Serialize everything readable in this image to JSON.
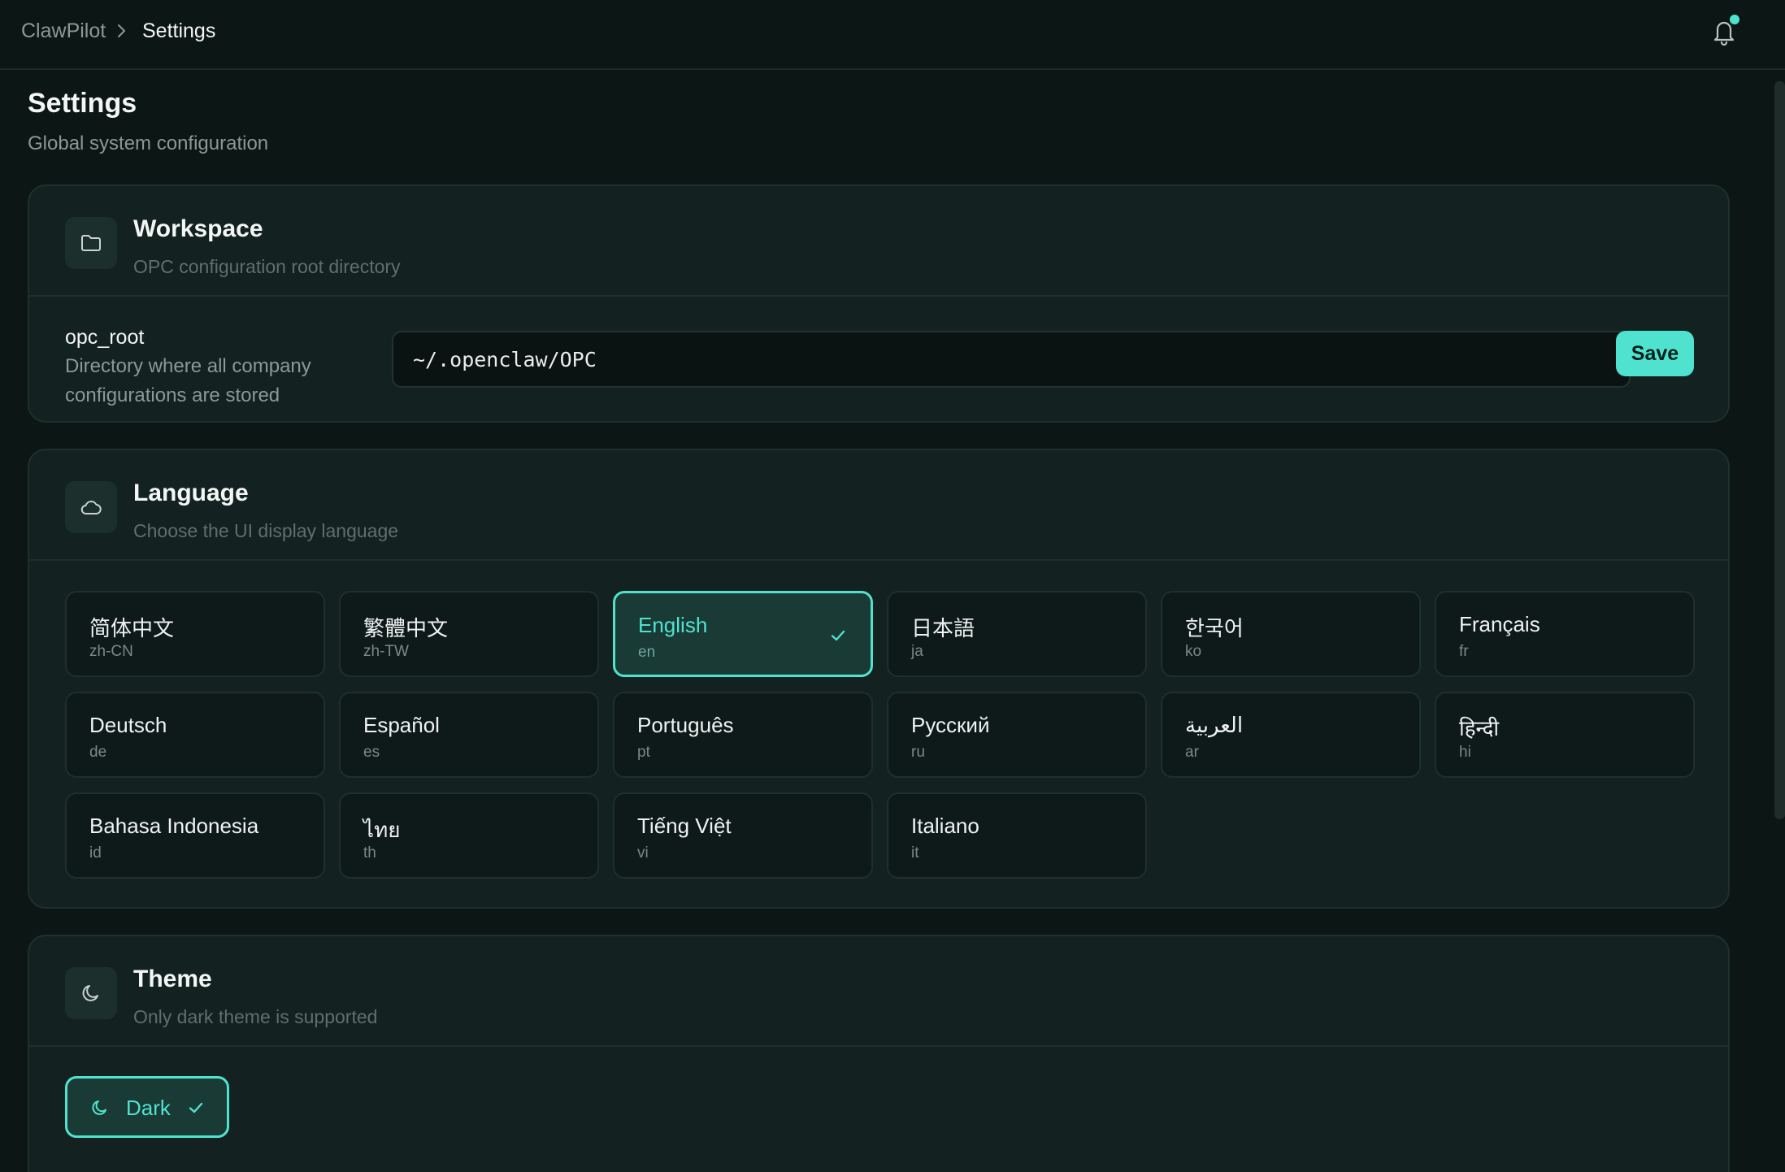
{
  "breadcrumb": {
    "root": "ClawPilot",
    "current": "Settings"
  },
  "page": {
    "title": "Settings",
    "subtitle": "Global system configuration"
  },
  "workspace": {
    "title": "Workspace",
    "description": "OPC configuration root directory",
    "field_name": "opc_root",
    "field_help": "Directory where all company configurations are stored",
    "field_value": "~/.openclaw/OPC",
    "save_label": "Save"
  },
  "language": {
    "title": "Language",
    "description": "Choose the UI display language",
    "selected": "en",
    "items": [
      {
        "name": "简体中文",
        "code": "zh-CN"
      },
      {
        "name": "繁體中文",
        "code": "zh-TW"
      },
      {
        "name": "English",
        "code": "en"
      },
      {
        "name": "日本語",
        "code": "ja"
      },
      {
        "name": "한국어",
        "code": "ko"
      },
      {
        "name": "Français",
        "code": "fr"
      },
      {
        "name": "Deutsch",
        "code": "de"
      },
      {
        "name": "Español",
        "code": "es"
      },
      {
        "name": "Português",
        "code": "pt"
      },
      {
        "name": "Русский",
        "code": "ru"
      },
      {
        "name": "العربية",
        "code": "ar"
      },
      {
        "name": "हिन्दी",
        "code": "hi"
      },
      {
        "name": "Bahasa Indonesia",
        "code": "id"
      },
      {
        "name": "ไทย",
        "code": "th"
      },
      {
        "name": "Tiếng Việt",
        "code": "vi"
      },
      {
        "name": "Italiano",
        "code": "it"
      }
    ]
  },
  "theme": {
    "title": "Theme",
    "description": "Only dark theme is supported",
    "option_label": "Dark"
  },
  "icons": {
    "workspace": "folder-icon",
    "language": "cloud-icon",
    "theme": "moon-icon",
    "notifications": "bell-icon"
  },
  "colors": {
    "accent": "#4fe3cf",
    "background": "#0c1615",
    "card": "#132220"
  }
}
